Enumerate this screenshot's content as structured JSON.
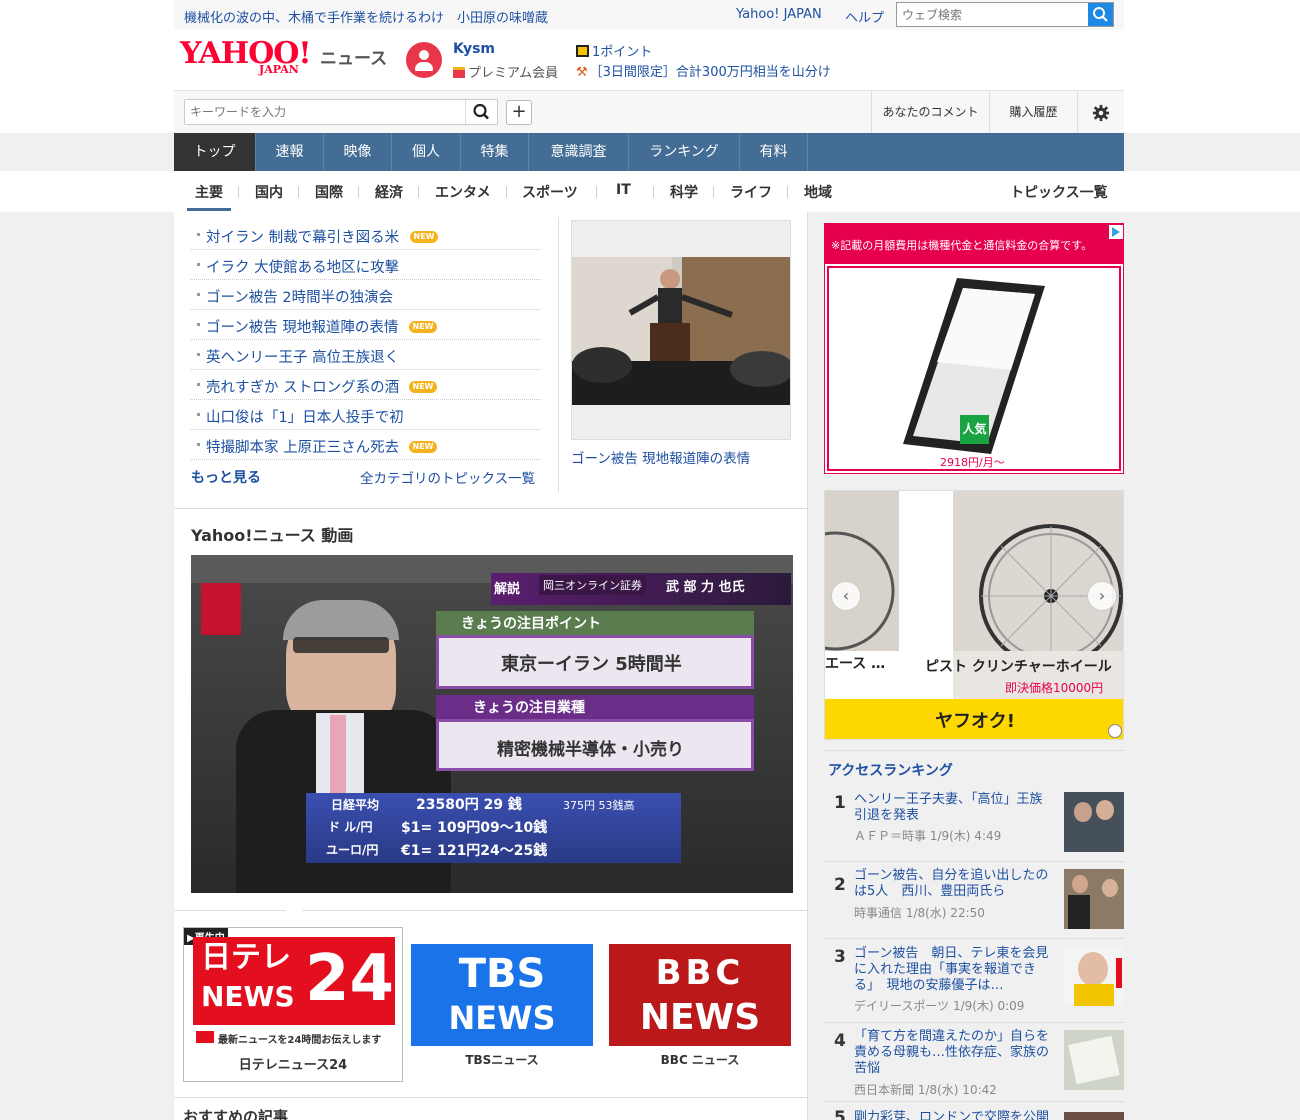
{
  "topbar": {
    "links": [
      "機械化の波の中、木桶で手作業を続けるわけ",
      "小田原の味噌蔵"
    ],
    "yahoo_japan": "Yahoo! JAPAN",
    "help": "ヘルプ",
    "web_search_placeholder": "ウェブ検索"
  },
  "header": {
    "logo_yahoo": "YAHOO!",
    "logo_japan": "JAPAN",
    "logo_news": "ニュース",
    "username": "Kysm",
    "membership": "プレミアム会員",
    "points": "1ポイント",
    "campaign": "［3日間限定］合計300万円相当を山分け"
  },
  "search": {
    "keyword_placeholder": "キーワードを入力",
    "your_comments": "あなたのコメント",
    "purchase_history": "購入履歴"
  },
  "nav": {
    "items": [
      "トップ",
      "速報",
      "映像",
      "個人",
      "特集",
      "意識調査",
      "ランキング",
      "有料"
    ],
    "active": "トップ"
  },
  "subnav": {
    "items": [
      "主要",
      "国内",
      "国際",
      "経済",
      "エンタメ",
      "スポーツ",
      "IT",
      "科学",
      "ライフ",
      "地域"
    ],
    "all_topics": "トピックス一覧"
  },
  "topics": {
    "items": [
      {
        "title": "対イラン 制裁で幕引き図る米",
        "new": true
      },
      {
        "title": "イラク 大使館ある地区に攻撃",
        "new": false
      },
      {
        "title": "ゴーン被告 2時間半の独演会",
        "new": false
      },
      {
        "title": "ゴーン被告 現地報道陣の表情",
        "new": true
      },
      {
        "title": "英ヘンリー王子 高位王族退く",
        "new": false
      },
      {
        "title": "売れすぎか ストロング系の酒",
        "new": true
      },
      {
        "title": "山口俊は「1」日本人投手で初",
        "new": false
      },
      {
        "title": "特撮脚本家 上原正三さん死去",
        "new": true
      }
    ],
    "new_label": "NEW",
    "more": "もっと見る",
    "all_categories": "全カテゴリのトピックス一覧",
    "photo_caption": "ゴーン被告 現地報道陣の表情"
  },
  "video": {
    "heading": "Yahoo!ニュース 動画",
    "overlay": {
      "label_kaisetsu": "解説",
      "commentator": "岡三オンライン証券",
      "commentator_name": "武 部 力 也氏",
      "point_header": "きょうの注目ポイント",
      "point": "東京ーイラン 5時間半",
      "sector_header": "きょうの注目業種",
      "sector": "精密機械半導体・小売り",
      "nikkei_label": "日経平均",
      "nikkei_value": "23580円 29 銭",
      "nikkei_change": "375円 53銭高",
      "usd_label": "ド ル/円",
      "usd_value": "$1= 109円09～10銭",
      "eur_label": "ユーロ/円",
      "eur_value": "€1= 121円24～25銭",
      "channel_bug": "日テレNEWS24"
    },
    "channels": [
      {
        "name": "日テレニュース24",
        "logo_line1": "日テレ",
        "logo_line2": "NEWS",
        "logo_num": "24",
        "tagline": "最新ニュースを24時間お伝えします",
        "playing": true
      },
      {
        "name": "TBSニュース",
        "logo_line1": "TBS",
        "logo_line2": "NEWS",
        "playing": false
      },
      {
        "name": "BBC ニュース",
        "logo_line1": "BBC",
        "logo_line2": "NEWS",
        "playing": false
      }
    ],
    "playing_label": "▶再生中"
  },
  "recommended": {
    "heading": "おすすめの記事"
  },
  "ads": {
    "disclaimer": "※記載の月額費用は機種代金と通信料金の合算です。",
    "badge": "人気",
    "price": "2918円/月～",
    "auction": {
      "left_item": "エース …",
      "main_item": "ピスト クリンチャーホイール",
      "price": "即決価格10000円",
      "brand": "ヤフオク!"
    }
  },
  "ranking": {
    "heading": "アクセスランキング",
    "items": [
      {
        "rank": "1",
        "title": "ヘンリー王子夫妻、「高位」王族引退を発表",
        "meta": "ＡＦＰ＝時事 1/9(木) 4:49"
      },
      {
        "rank": "2",
        "title": "ゴーン被告、自分を追い出したのは5人　西川、豊田両氏ら",
        "meta": "時事通信 1/8(水) 22:50"
      },
      {
        "rank": "3",
        "title": "ゴーン被告　朝日、テレ東を会見に入れた理由「事実を報道できる」　現地の安藤優子は…",
        "meta": "デイリースポーツ 1/9(木) 0:09"
      },
      {
        "rank": "4",
        "title": "「育て方を間違えたのか」自らを責める母親も…性依存症、家族の苦悩",
        "meta": "西日本新聞 1/8(水) 10:42"
      },
      {
        "rank": "5",
        "title": "剛力彩芽、ロンドンで交際を公開",
        "meta": ""
      }
    ]
  },
  "colors": {
    "link": "#1e50a2",
    "nav_bg": "#446d95",
    "nav_active": "#333333",
    "new_badge": "#f5b31b",
    "brand_red": "#ff0033"
  }
}
